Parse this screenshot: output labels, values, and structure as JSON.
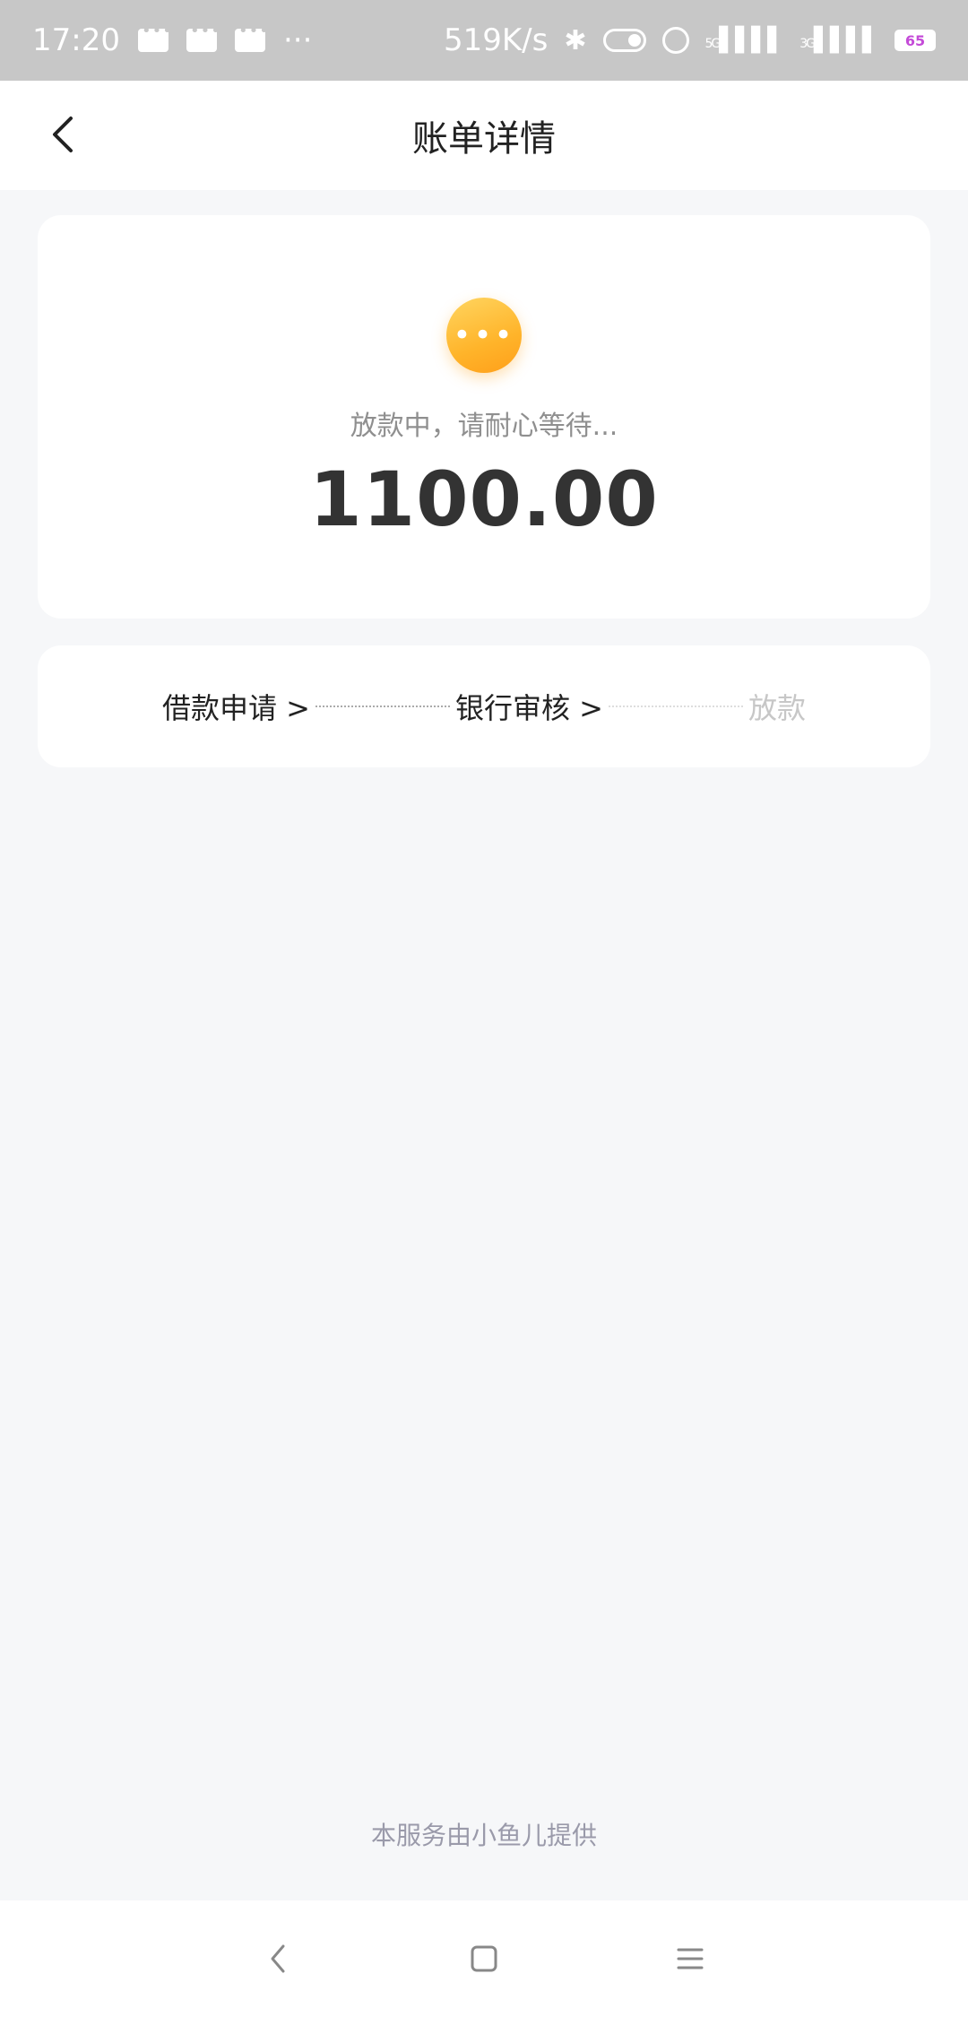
{
  "status_bar": {
    "time": "17:20",
    "more": "···",
    "net_speed": "519K/s",
    "signal1": "5G",
    "signal2": "3G",
    "battery": "65"
  },
  "header": {
    "title": "账单详情",
    "back_icon": "chevron-left-icon"
  },
  "hero": {
    "icon": "ellipsis-icon",
    "status_text": "放款中，请耐心等待...",
    "amount": "1100.00"
  },
  "steps": [
    {
      "label": "借款申请 >",
      "state": "done"
    },
    {
      "label": "银行审核 >",
      "state": "done"
    },
    {
      "label": "放款",
      "state": "pending"
    }
  ],
  "footer": {
    "provider_text": "本服务由小鱼儿提供"
  },
  "nav": {
    "back": "back-icon",
    "home": "home-icon",
    "menu": "menu-icon"
  },
  "colors": {
    "accent": "#ffb42a",
    "background": "#f6f7f9",
    "status_bar": "#c7c7c7"
  }
}
